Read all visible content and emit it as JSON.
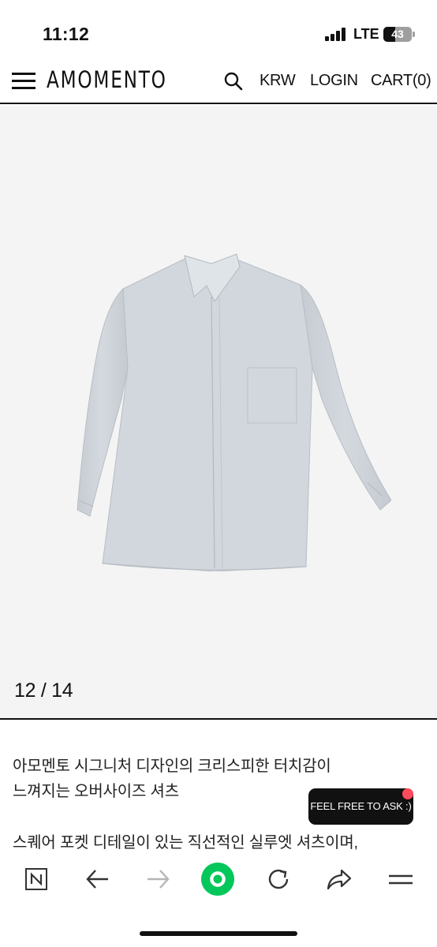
{
  "status": {
    "time": "11:12",
    "network": "LTE",
    "battery_level": "43",
    "battery_fraction": 0.43
  },
  "header": {
    "logo": "AMOMENTO",
    "currency": "KRW",
    "login": "LOGIN",
    "cart": "CART(0)"
  },
  "gallery": {
    "counter": "12 / 14",
    "current": 12,
    "total": 14,
    "shirt_color": "#cdd3d8"
  },
  "description": {
    "line1": "아모멘토 시그니처 디자인의 크리스피한 터치감이",
    "line2": "느껴지는 오버사이즈 셔츠",
    "line3": "스퀘어 포켓 디테일이 있는 직선적인 실루엣 셔츠이며,"
  },
  "chat": {
    "label": "FEEL FREE TO ASK :)",
    "dot_color": "#ff4b5c"
  },
  "browser_toolbar": {
    "icons": [
      "naver-n-icon",
      "back-arrow-icon",
      "forward-arrow-icon",
      "green-home-icon",
      "refresh-icon",
      "share-icon",
      "menu-icon"
    ],
    "accent": "#03c75a"
  }
}
